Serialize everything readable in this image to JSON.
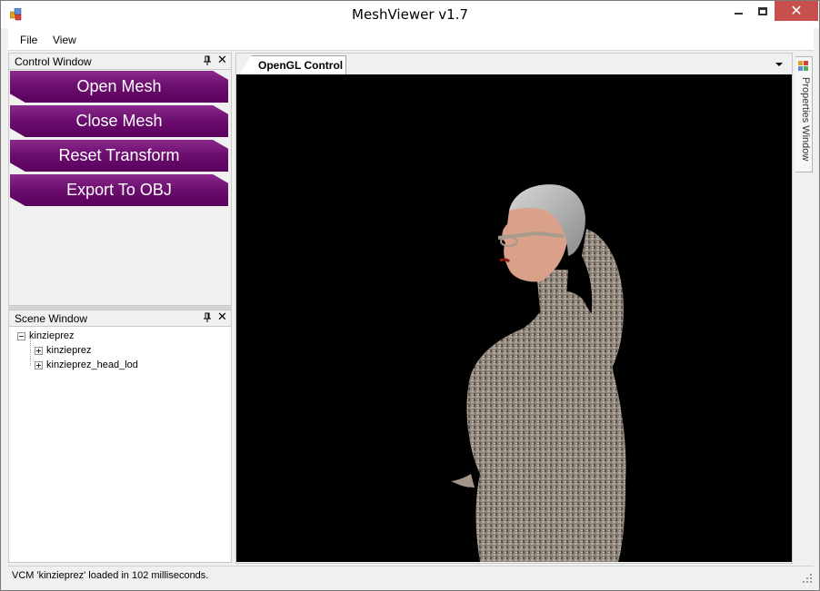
{
  "window": {
    "title": "MeshViewer v1.7",
    "icon": "app-icon"
  },
  "menu": {
    "file": "File",
    "view": "View"
  },
  "control_window": {
    "title": "Control Window",
    "buttons": [
      {
        "label": "Open Mesh"
      },
      {
        "label": "Close Mesh"
      },
      {
        "label": "Reset Transform"
      },
      {
        "label": "Export To OBJ"
      }
    ],
    "button_color": "#6d0f70"
  },
  "scene_window": {
    "title": "Scene Window",
    "tree": {
      "root": "kinzieprez",
      "children": [
        "kinzieprez",
        "kinzieprez_head_lod"
      ]
    }
  },
  "document": {
    "tab_label": "OpenGL Control",
    "viewport_bg": "#000000"
  },
  "side_panel": {
    "label": "Properties Window"
  },
  "status": {
    "text": "VCM 'kinzieprez' loaded in 102 milliseconds."
  }
}
